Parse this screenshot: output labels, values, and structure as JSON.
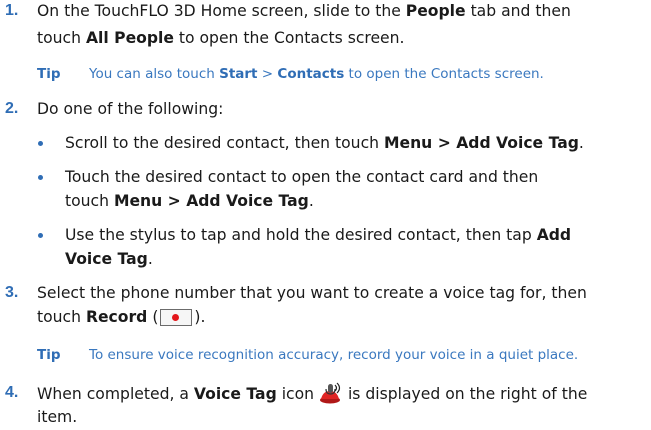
{
  "step1": {
    "number": "1.",
    "line1": {
      "a": "On the TouchFLO 3D Home screen, slide to the ",
      "b": "People",
      "c": " tab and then"
    },
    "line2": {
      "a": "touch ",
      "b": "All People",
      "c": " to open the Contacts screen."
    }
  },
  "tip1": {
    "label": "Tip",
    "a": "You can also touch ",
    "b": "Start",
    "c": " > ",
    "d": "Contacts",
    "e": " to open the Contacts screen."
  },
  "step2": {
    "number": "2.",
    "text": "Do one of the following:"
  },
  "bullets": [
    {
      "a": "Scroll to the desired contact, then touch ",
      "b": "Menu",
      "c": " > ",
      "d": "Add Voice Tag",
      "e": "."
    },
    {
      "line1": "Touch the desired contact to open the contact card and then",
      "a": "touch ",
      "b": "Menu",
      "c": " > ",
      "d": "Add Voice Tag",
      "e": "."
    },
    {
      "line1a": "Use the stylus to tap and hold the desired contact, then tap ",
      "line1b": "Add",
      "line2b": "Voice Tag",
      "line2c": "."
    }
  ],
  "step3": {
    "number": "3.",
    "line1": "Select the phone number that you want to create a voice tag for, then",
    "a": "touch ",
    "b": "Record",
    "c": " (",
    "d": ")."
  },
  "tip2": {
    "label": "Tip",
    "text": "To ensure voice recognition accuracy, record your voice in a quiet place."
  },
  "step4": {
    "number": "4.",
    "a": "When completed, a ",
    "b": "Voice Tag",
    "c": " icon ",
    "d": " is displayed on the right of the",
    "line2": "item."
  },
  "icons": {
    "record": "record-button-icon",
    "voice_tag": "voice-tag-icon"
  },
  "colors": {
    "accent": "#2f6db5",
    "tip_text": "#3a78bf",
    "record_dot": "#e3161b"
  }
}
